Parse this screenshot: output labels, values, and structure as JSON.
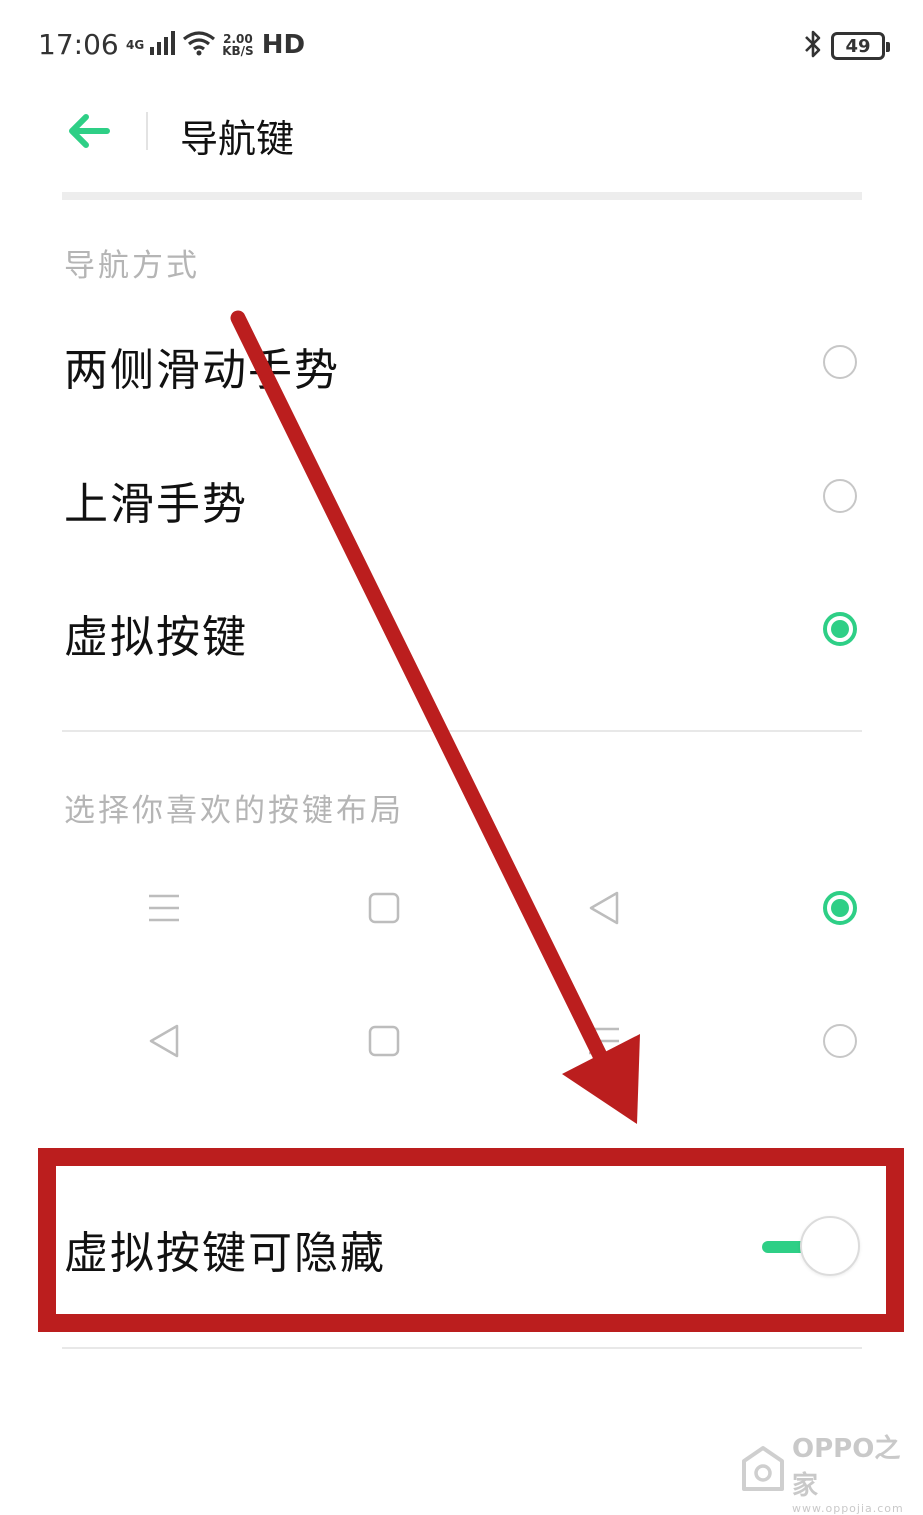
{
  "status_bar": {
    "time": "17:06",
    "network_type": "4G",
    "speed_value": "2.00",
    "speed_unit": "KB/S",
    "hd": "HD",
    "battery": "49"
  },
  "header": {
    "title": "导航键"
  },
  "navigation": {
    "section_label": "导航方式",
    "options": [
      {
        "label": "两侧滑动手势",
        "selected": false
      },
      {
        "label": "上滑手势",
        "selected": false
      },
      {
        "label": "虚拟按键",
        "selected": true
      }
    ]
  },
  "layout": {
    "section_label": "选择你喜欢的按键布局",
    "rows": [
      {
        "keys": [
          "menu-icon",
          "square-icon",
          "triangle-back-icon"
        ],
        "selected": true
      },
      {
        "keys": [
          "triangle-back-icon",
          "square-icon",
          "menu-icon"
        ],
        "selected": false
      }
    ]
  },
  "hide_setting": {
    "label": "虚拟按键可隐藏",
    "enabled": true
  },
  "colors": {
    "accent": "#2ecf86",
    "annotation": "#bb1e1e"
  },
  "watermark": {
    "brand": "OPPO之家",
    "url": "www.oppojia.com"
  }
}
